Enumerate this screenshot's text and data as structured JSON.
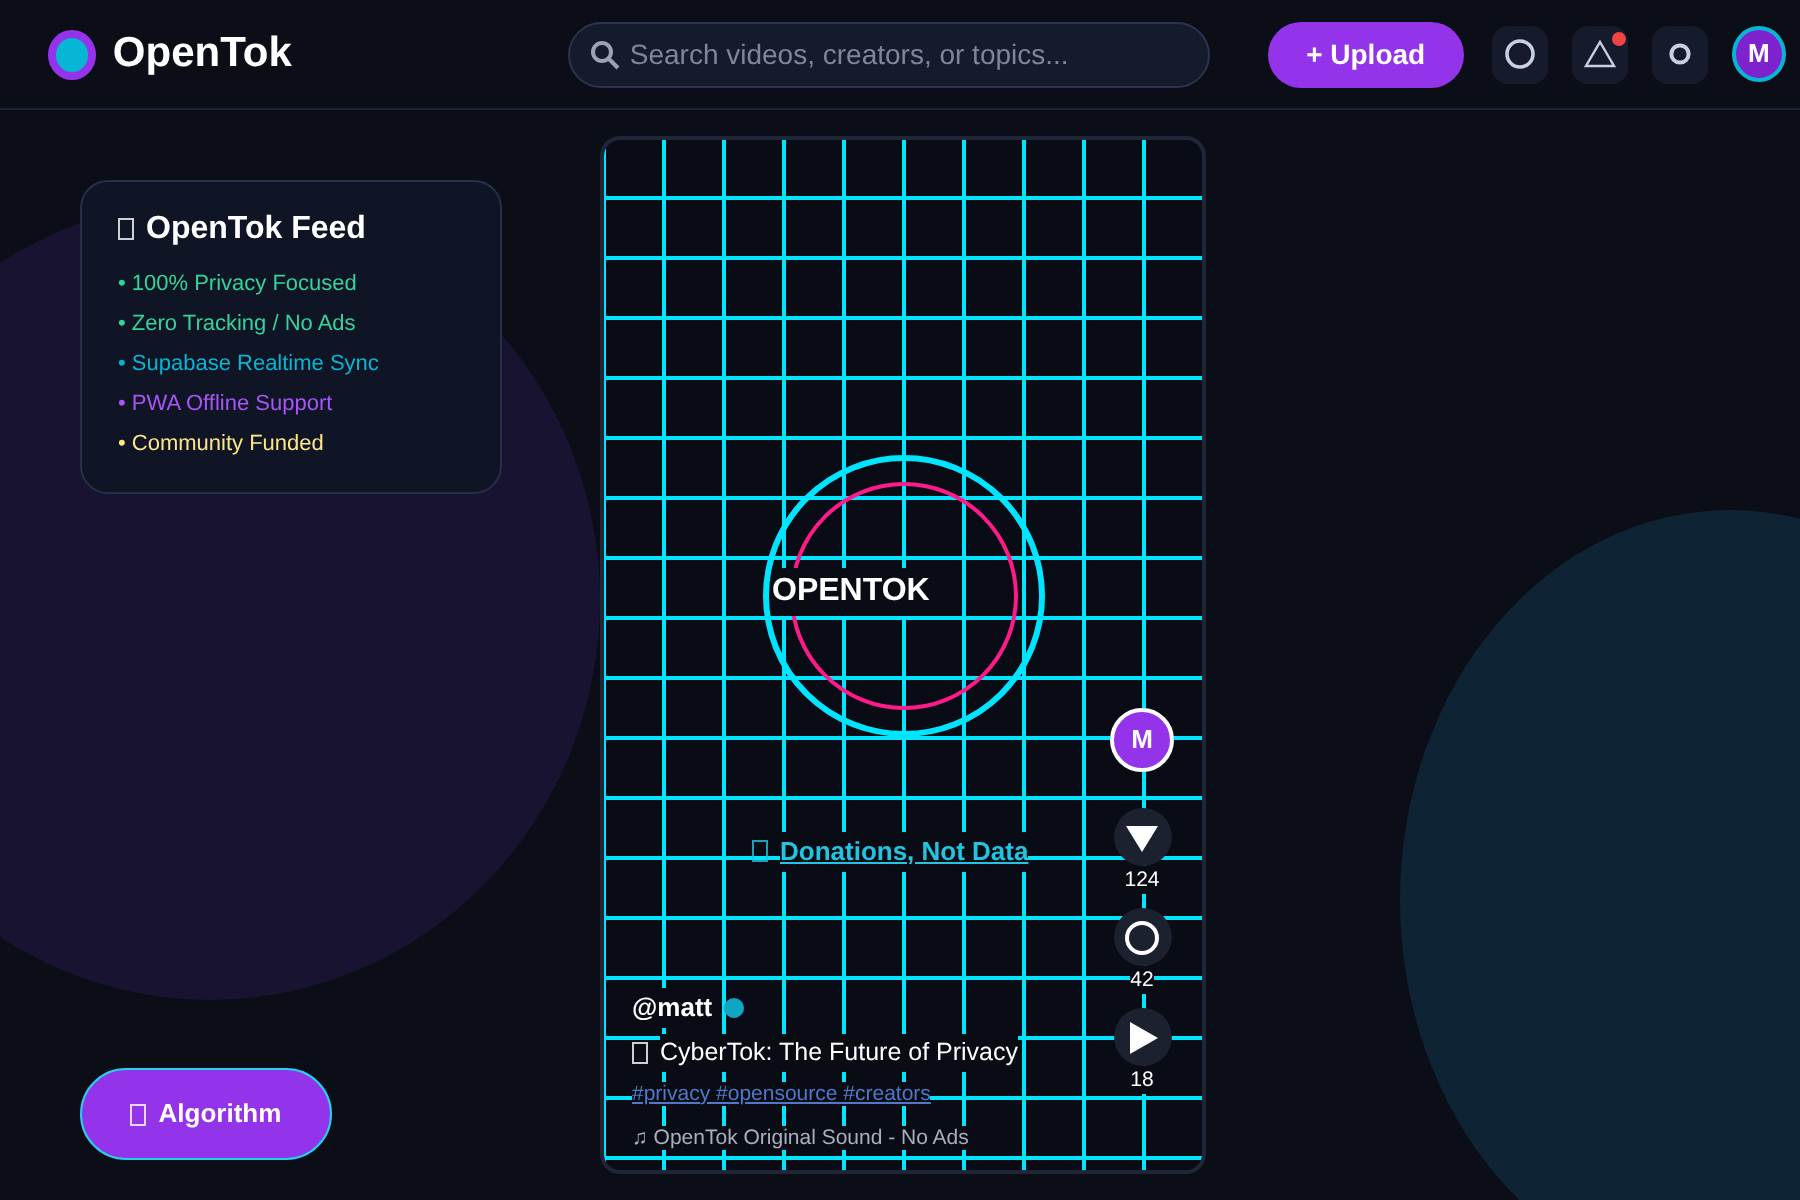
{
  "header": {
    "brand": "OpenTok",
    "search": {
      "placeholder": "Search videos, creators, or topics..."
    },
    "upload_button": "+ Upload",
    "notification_unread": true,
    "avatar": "M"
  },
  "feed_panel": {
    "title": "OpenTok Feed",
    "features": [
      {
        "text": "• 100% Privacy Focused",
        "color": "#34d399"
      },
      {
        "text": "• Zero Tracking / No Ads",
        "color": "#34d399"
      },
      {
        "text": "• Supabase Realtime Sync",
        "color": "#06b6d4"
      },
      {
        "text": "• PWA Offline Support",
        "color": "#a855f7"
      },
      {
        "text": "• Community Funded",
        "color": "#fde68a"
      }
    ]
  },
  "algorithm_button": "Algorithm",
  "video": {
    "logo_text": "OPENTOK",
    "tagline": "Donations, Not Data",
    "handle": "@matt",
    "avatar": "M",
    "caption": "CyberTok: The Future of Privacy",
    "hashtags": "#privacy #opensource #creators",
    "sound": "♫ OpenTok Original Sound - No Ads",
    "actions": [
      {
        "kind": "like",
        "count": "124"
      },
      {
        "kind": "comment",
        "count": "42"
      },
      {
        "kind": "share",
        "count": "18"
      }
    ]
  }
}
